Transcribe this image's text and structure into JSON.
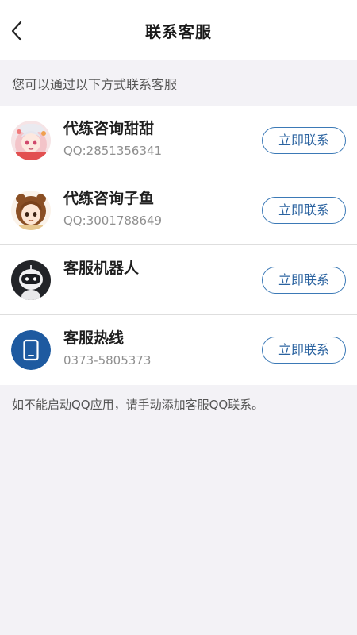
{
  "header": {
    "title": "联系客服",
    "back_icon": "chevron-left-icon"
  },
  "intro_text": "您可以通过以下方式联系客服",
  "contacts": [
    {
      "name": "代练咨询甜甜",
      "detail": "QQ:2851356341",
      "button_label": "立即联系",
      "avatar": "anime-girl-avatar-icon"
    },
    {
      "name": "代练咨询子鱼",
      "detail": "QQ:3001788649",
      "button_label": "立即联系",
      "avatar": "anime-girl-brown-hair-avatar-icon"
    },
    {
      "name": "客服机器人",
      "detail": "",
      "button_label": "立即联系",
      "avatar": "robot-avatar-icon"
    },
    {
      "name": "客服热线",
      "detail": "0373-5805373",
      "button_label": "立即联系",
      "avatar": "phone-icon"
    }
  ],
  "footer_note": "如不能启动QQ应用，请手动添加客服QQ联系。",
  "colors": {
    "accent": "#2b63a0",
    "button_border": "#3b79b6",
    "background": "#f3f2f6",
    "phone_icon_bg": "#1e5aa0"
  }
}
